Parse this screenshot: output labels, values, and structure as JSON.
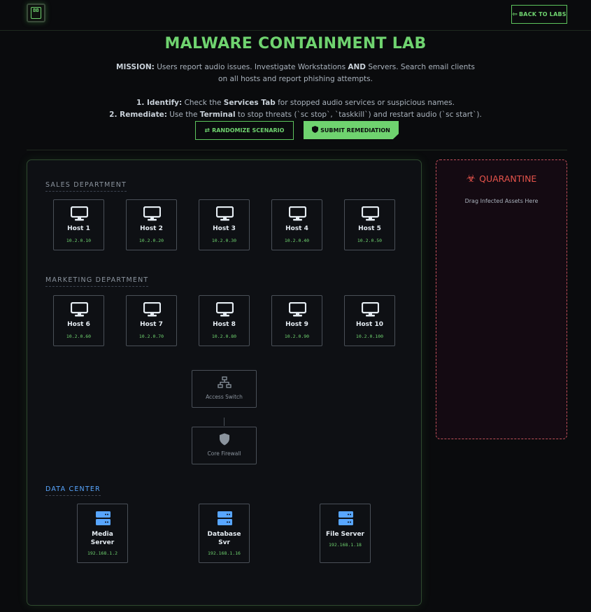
{
  "header": {
    "logo_text": "BB",
    "back_label": "BACK TO LABS"
  },
  "title": "MALWARE CONTAINMENT LAB",
  "mission": {
    "label": "MISSION:",
    "text_1": " Users report audio issues. Investigate Workstations ",
    "and": "AND",
    "text_2": " Servers. Search email clients on all hosts and report phishing attempts."
  },
  "steps": {
    "step1_label": "1. Identify:",
    "step1_a": " Check the ",
    "step1_b": "Services Tab",
    "step1_c": " for stopped audio services or suspicious names.",
    "step2_label": "2. Remediate:",
    "step2_a": " Use the ",
    "step2_b": "Terminal",
    "step2_c": " to stop threats (`sc stop`, `taskkill`) and restart audio (`sc start`)."
  },
  "actions": {
    "randomize_label": "RANDOMIZE SCENARIO",
    "submit_label": "SUBMIT REMEDIATION"
  },
  "sales": {
    "label": "SALES DEPARTMENT",
    "hosts": [
      {
        "name": "Host 1",
        "ip": "10.2.0.10"
      },
      {
        "name": "Host 2",
        "ip": "10.2.0.20"
      },
      {
        "name": "Host 3",
        "ip": "10.2.0.30"
      },
      {
        "name": "Host 4",
        "ip": "10.2.0.40"
      },
      {
        "name": "Host 5",
        "ip": "10.2.0.50"
      }
    ]
  },
  "marketing": {
    "label": "MARKETING DEPARTMENT",
    "hosts": [
      {
        "name": "Host 6",
        "ip": "10.2.0.60"
      },
      {
        "name": "Host 7",
        "ip": "10.2.0.70"
      },
      {
        "name": "Host 8",
        "ip": "10.2.0.80"
      },
      {
        "name": "Host 9",
        "ip": "10.2.0.90"
      },
      {
        "name": "Host 10",
        "ip": "10.2.0.100"
      }
    ]
  },
  "infra": {
    "switch_label": "Access Switch",
    "firewall_label": "Core Firewall"
  },
  "datacenter": {
    "label": "DATA CENTER",
    "servers": [
      {
        "name_1": "Media",
        "name_2": "Server",
        "ip": "192.168.1.2"
      },
      {
        "name_1": "Database",
        "name_2": "Svr",
        "ip": "192.168.1.16"
      },
      {
        "name_1": "File Server",
        "name_2": "",
        "ip": "192.168.1.18"
      }
    ]
  },
  "quarantine": {
    "title": "QUARANTINE",
    "subtitle": "Drag Infected Assets Here"
  },
  "colors": {
    "accent": "#6fd36f",
    "danger": "#e5534b",
    "server_blue": "#58a6ff"
  }
}
